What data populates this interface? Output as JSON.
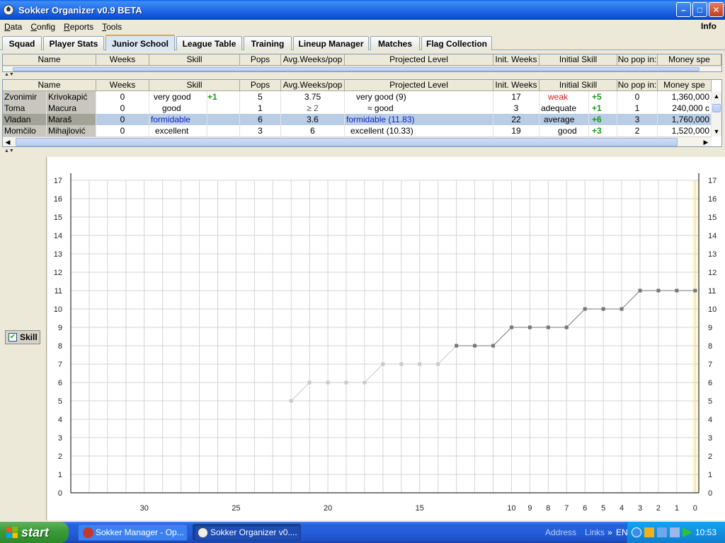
{
  "window": {
    "title": "Sokker Organizer v0.9 BETA",
    "minimize": "–",
    "maximize": "□",
    "close": "✕"
  },
  "menu": {
    "items": [
      {
        "hot": "D",
        "rest": "ata"
      },
      {
        "hot": "C",
        "rest": "onfig"
      },
      {
        "hot": "R",
        "rest": "eports"
      },
      {
        "hot": "T",
        "rest": "ools"
      }
    ],
    "info": "Info"
  },
  "tabs": [
    "Squad",
    "Player Stats",
    "Junior School",
    "League Table",
    "Training",
    "Lineup Manager",
    "Matches",
    "Flag Collection"
  ],
  "active_tab": "Junior School",
  "columns": [
    "Name",
    "Weeks",
    "Skill",
    "Pops",
    "Avg.Weeks/pop",
    "Projected Level",
    "Init. Weeks",
    "Initial Skill",
    "No pop in:",
    "Money spe"
  ],
  "juniors": [
    {
      "first": "Zvonimir",
      "last": "Krivokapić",
      "weeks": "0",
      "skill": "very good",
      "skill_gain": "+1",
      "pops": "5",
      "avg": "3.75",
      "projected": "very good (9)",
      "init_weeks": "17",
      "init_skill": "weak",
      "init_gain": "+5",
      "no_pop": "0",
      "money": "1,360,000"
    },
    {
      "first": "Toma",
      "last": "Macura",
      "weeks": "0",
      "skill": "good",
      "skill_gain": "",
      "pops": "1",
      "avg": "≥ 2",
      "projected": "≈ good",
      "init_weeks": "3",
      "init_skill": "adequate",
      "init_gain": "+1",
      "no_pop": "1",
      "money": "240,000 c"
    },
    {
      "first": "Vladan",
      "last": "Maraš",
      "weeks": "0",
      "skill": "formidable",
      "skill_gain": "",
      "pops": "6",
      "avg": "3.6",
      "projected": "formidable (11.83)",
      "init_weeks": "22",
      "init_skill": "average",
      "init_gain": "+6",
      "no_pop": "3",
      "money": "1,760,000"
    },
    {
      "first": "Momčilo",
      "last": "Mihajlović",
      "weeks": "0",
      "skill": "excellent",
      "skill_gain": "",
      "pops": "3",
      "avg": "6",
      "projected": "excellent (10.33)",
      "init_weeks": "19",
      "init_skill": "good",
      "init_gain": "+3",
      "no_pop": "2",
      "money": "1,520,000"
    }
  ],
  "chart_toggle": {
    "label": "Skill",
    "checked": true
  },
  "chart_data": {
    "type": "line",
    "ylim": [
      0,
      17
    ],
    "yticks": [
      0,
      1,
      2,
      3,
      4,
      5,
      6,
      7,
      8,
      9,
      10,
      11,
      12,
      13,
      14,
      15,
      16,
      17
    ],
    "xlim": [
      34,
      -0.2
    ],
    "xtick_labels": [
      30,
      25,
      20,
      15,
      10,
      9,
      8,
      7,
      6,
      5,
      4,
      3,
      2,
      1,
      0
    ],
    "series": [
      {
        "x": [
          22,
          21,
          20,
          19,
          18,
          17,
          16,
          15,
          14,
          13,
          12,
          11,
          10,
          9,
          8,
          7,
          6,
          5,
          4,
          3,
          2,
          1,
          0
        ],
        "values": [
          5,
          6,
          6,
          6,
          6,
          7,
          7,
          7,
          7,
          8,
          8,
          8,
          9,
          9,
          9,
          9,
          10,
          10,
          10,
          11,
          11,
          11,
          11
        ]
      }
    ],
    "highlight_x": 0
  },
  "colors": {
    "line": "#777777",
    "faded": "#c9c9c9",
    "grid": "#d4d4d4",
    "highlight": "#fff8d0"
  },
  "taskbar": {
    "start": "start",
    "tasks": [
      "Sokker Manager - Op...",
      "Sokker Organizer v0...."
    ],
    "links": [
      "Address",
      "Links"
    ],
    "links_more": "»",
    "lang": "EN",
    "clock": "10:53"
  }
}
